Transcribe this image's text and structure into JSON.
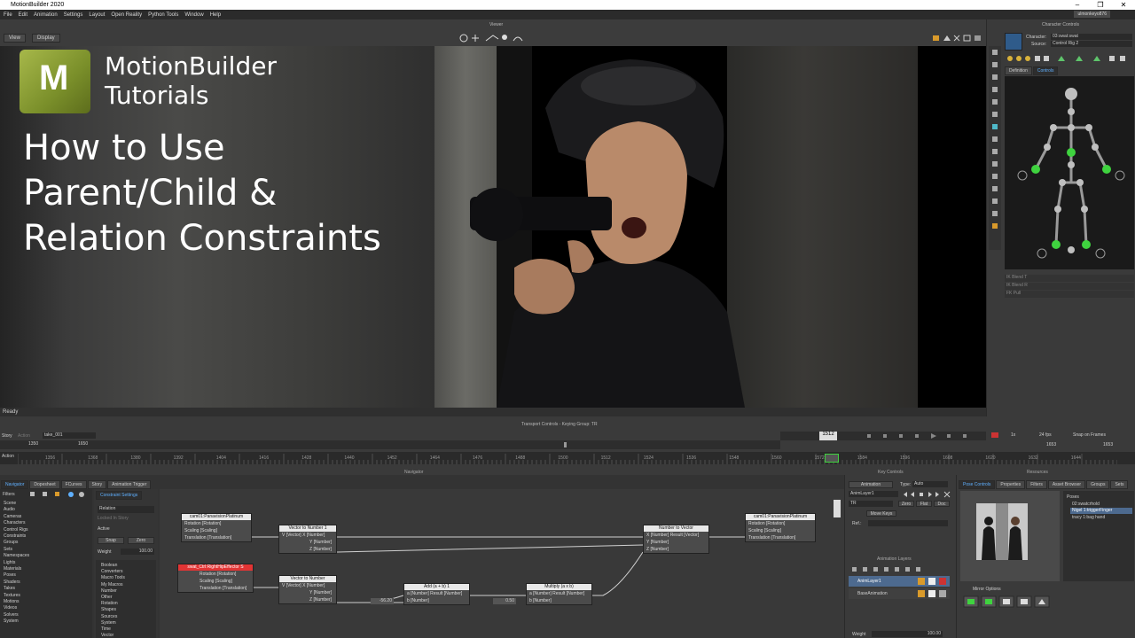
{
  "window": {
    "title": "MotionBuilder 2020"
  },
  "menu": [
    "File",
    "Edit",
    "Animation",
    "Settings",
    "Layout",
    "Open Reality",
    "Python Tools",
    "Window",
    "Help"
  ],
  "user": "ulmonkeyo876",
  "viewer": {
    "title": "Viewer",
    "view_btn": "View",
    "display_btn": "Display"
  },
  "overlay": {
    "logo_letter": "M",
    "tutorial_line1": "MotionBuilder",
    "tutorial_line2": "Tutorials",
    "headline_line1": "How to Use",
    "headline_line2": "Parent/Child &",
    "headline_line3": "Relation Constraints"
  },
  "status": {
    "text": "Ready"
  },
  "character_controls": {
    "title": "Character Controls",
    "character_label": "Character:",
    "character_value": "03:swat:swat",
    "source_label": "Source:",
    "source_value": "Control Rig 2",
    "tab_definition": "Definition",
    "tab_controls": "Controls",
    "ik_rows": [
      "IK Blend T",
      "IK Blend R",
      "FK Pull"
    ]
  },
  "transport": {
    "title": "Transport Controls - Keying Group: TR",
    "story_label": "Story",
    "action_label": "Action",
    "take_value": "take_001",
    "start_value": "1350",
    "end_value": "1650",
    "current_frame": "1512",
    "fps": "24 fps",
    "snap": "Snap on Frames",
    "speed": "1x",
    "right_a": "1653",
    "right_b": "1653",
    "ticks": [
      "1356",
      "1368",
      "1380",
      "1392",
      "1404",
      "1416",
      "1428",
      "1440",
      "1452",
      "1464",
      "1476",
      "1488",
      "1500",
      "1512",
      "1524",
      "1536",
      "1548",
      "1560",
      "1572",
      "1584",
      "1596",
      "1608",
      "1620",
      "1632",
      "1644"
    ]
  },
  "navigator": {
    "title": "Navigator",
    "tabs": [
      "Navigator",
      "Dopesheet",
      "FCurves",
      "Story",
      "Animation Trigger"
    ],
    "filters": "Filters",
    "tree": [
      "Scene",
      "Audio",
      "Cameras",
      "Characters",
      "Control Rigs",
      "Constraints",
      "Groups",
      "Sets",
      "Namespaces",
      "Lights",
      "Materials",
      "Poses",
      "Shaders",
      "Takes",
      "Textures",
      "Motions",
      "Videos",
      "Solvers",
      "System"
    ],
    "constraint_tab": "Constraint Settings",
    "relation_label": "Relation",
    "lock_label": "Locked In Story",
    "active_label": "Active",
    "snap_btn": "Snap",
    "zero_btn": "Zero",
    "weight_label": "Weight",
    "weight_value": "100.00",
    "box_list": [
      "Boolean",
      "Converters",
      "Macro Tools",
      "My Macros",
      "Number",
      "Other",
      "Rotation",
      "Shapes",
      "Sources",
      "System",
      "Time",
      "Vector"
    ]
  },
  "relation": {
    "nodes": {
      "cam_src": {
        "title": "cam01:PanavisionPlatinum",
        "rows": [
          "Rotation [Rotation]",
          "Scaling [Scaling]",
          "Translation [Translation]"
        ]
      },
      "swat_src": {
        "title": "swat_Ctrl:RightHipEffector S",
        "rows": [
          "Rotation [Rotation]",
          "Scaling [Scaling]",
          "Translation [Translation]"
        ]
      },
      "v2n_1": {
        "title": "Vector to Number 1",
        "in": "V [Vector]",
        "rows": [
          "X [Number]",
          "Y [Number]",
          "Z [Number]"
        ]
      },
      "v2n_2": {
        "title": "Vector to Number",
        "in": "V [Vector]",
        "rows": [
          "X [Number]",
          "Y [Number]",
          "Z [Number]"
        ]
      },
      "add": {
        "title": "Add (a + b) 1",
        "rows": [
          "a [Number]",
          "b [Number]"
        ],
        "out": "Result [Number]",
        "value": "-56.20"
      },
      "mult": {
        "title": "Multiply (a x b)",
        "rows": [
          "a [Number]",
          "b [Number]"
        ],
        "out": "Result [Number]",
        "value": "0.50"
      },
      "n2v": {
        "title": "Number to Vector",
        "rows": [
          "X [Number]",
          "Y [Number]",
          "Z [Number]"
        ],
        "out": "Result [Vector]"
      },
      "cam_dst": {
        "title": "cam01:PanavisionPlatinum",
        "rows": [
          "Rotation [Rotation]",
          "Scaling [Scaling]",
          "Translation [Translation]"
        ]
      }
    }
  },
  "key_controls": {
    "title": "Key Controls",
    "animation_btn": "Animation",
    "type_label": "Type:",
    "type_value": "Auto",
    "layer_value": "AnimLayer1",
    "tr_value": "TR",
    "zero_btn": "Zero",
    "flat_btn": "Flat",
    "doc_btn": "Doc",
    "move_keys": "Move Keys",
    "ref_label": "Ref.:",
    "anim_layers_title": "Animation Layers",
    "layers": [
      "AnimLayer1",
      "BaseAnimation"
    ],
    "weight_label": "Weight",
    "weight_value": "100.00"
  },
  "resources": {
    "title": "Resources",
    "tabs": [
      "Pose Controls",
      "Properties",
      "Filters",
      "Asset Browser",
      "Groups",
      "Sets"
    ],
    "poses_root": "Poses",
    "poses": [
      "02:swatcrhold",
      "Nigel 1:triggerFinger",
      "tracy 1:bag hand"
    ],
    "mirror": "Mirror Options"
  },
  "colors": {
    "accent_blue": "#5fb0ff",
    "node_red": "#e23434",
    "rig_green": "#3fd33f"
  }
}
